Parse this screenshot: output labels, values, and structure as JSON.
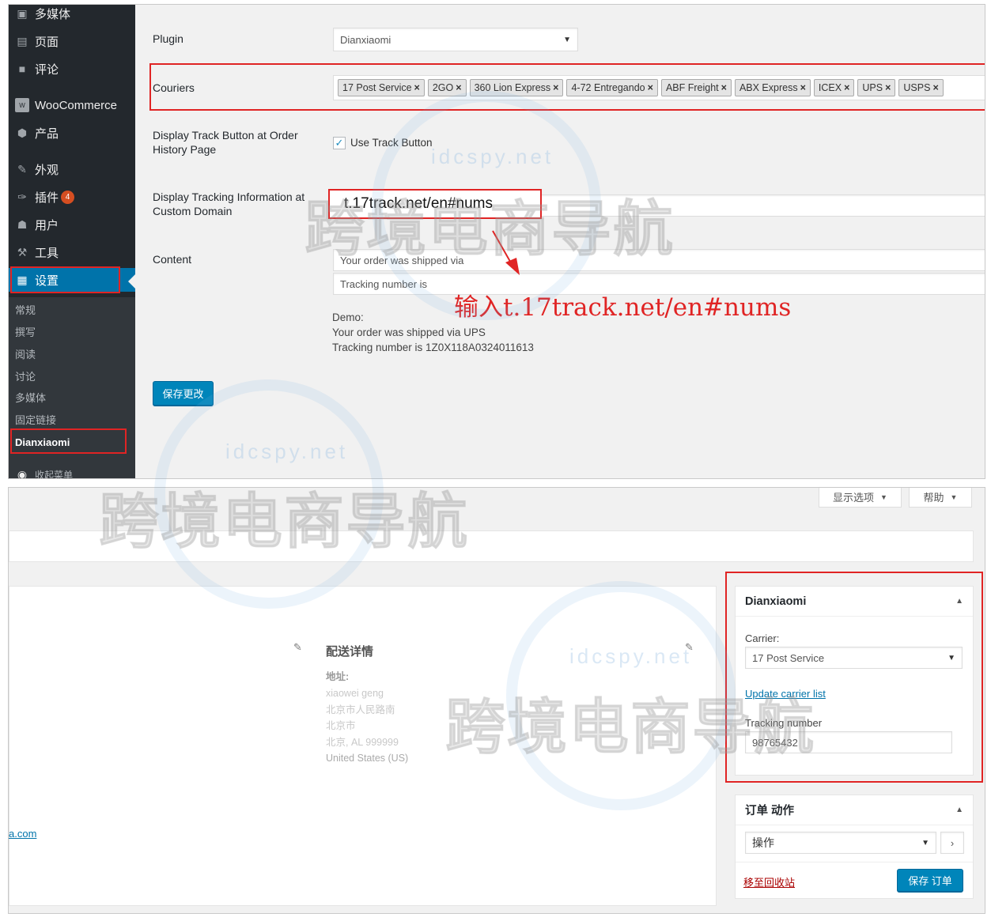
{
  "sidebar": {
    "items": [
      {
        "label": "多媒体",
        "icon": "media-icon"
      },
      {
        "label": "页面",
        "icon": "pages-icon"
      },
      {
        "label": "评论",
        "icon": "comments-icon"
      },
      {
        "label": "WooCommerce",
        "icon": "woocommerce-icon"
      },
      {
        "label": "产品",
        "icon": "products-icon"
      },
      {
        "label": "外观",
        "icon": "appearance-icon"
      },
      {
        "label": "插件",
        "icon": "plugins-icon",
        "badge": "4"
      },
      {
        "label": "用户",
        "icon": "users-icon"
      },
      {
        "label": "工具",
        "icon": "tools-icon"
      },
      {
        "label": "设置",
        "icon": "settings-icon"
      }
    ],
    "submenu": [
      "常规",
      "撰写",
      "阅读",
      "讨论",
      "多媒体",
      "固定链接",
      "Dianxiaomi"
    ],
    "collapse_label": "收起菜单"
  },
  "settings_form": {
    "plugin_label": "Plugin",
    "plugin_value": "Dianxiaomi",
    "couriers_label": "Couriers",
    "couriers": [
      "17 Post Service",
      "2GO",
      "360 Lion Express",
      "4-72 Entregando",
      "ABF Freight",
      "ABX Express",
      "ICEX",
      "UPS",
      "USPS"
    ],
    "track_button_label": "Display Track Button at Order History Page",
    "track_button_checkbox": "Use Track Button",
    "custom_domain_label": "Display Tracking Information at Custom Domain",
    "custom_domain_value": "t.17track.net/en#nums",
    "content_label": "Content",
    "content_line1": "Your order was shipped via",
    "content_line2": "Tracking number is",
    "demo_title": "Demo:",
    "demo_line1": "Your order was shipped via UPS",
    "demo_line2": "Tracking number is 1Z0X118A0324011613",
    "save_button": "保存更改"
  },
  "annotation": "输入t.17track.net/en#nums",
  "order_page": {
    "screen_options": "显示选项",
    "help": "帮助",
    "shipping_title": "配送详情",
    "address_label": "地址:",
    "address_lines": [
      "xiaowei geng",
      "北京市人民路南",
      "北京市",
      "北京, AL 999999",
      "United States (US)"
    ],
    "email_fragment": "a.com",
    "dianxiaomi_box": {
      "title": "Dianxiaomi",
      "carrier_label": "Carrier:",
      "carrier_value": "17 Post Service",
      "update_link": "Update carrier list",
      "tracking_label": "Tracking number",
      "tracking_value": "98765432"
    },
    "order_actions": {
      "title": "订单 动作",
      "select_value": "操作",
      "trash_link": "移至回收站",
      "save_button": "保存 订单"
    }
  },
  "watermark": {
    "text": "跨境电商导航",
    "url": "idcspy.net"
  },
  "colors": {
    "accent": "#0073aa",
    "highlight": "#e02424",
    "sidebar": "#23282d"
  }
}
